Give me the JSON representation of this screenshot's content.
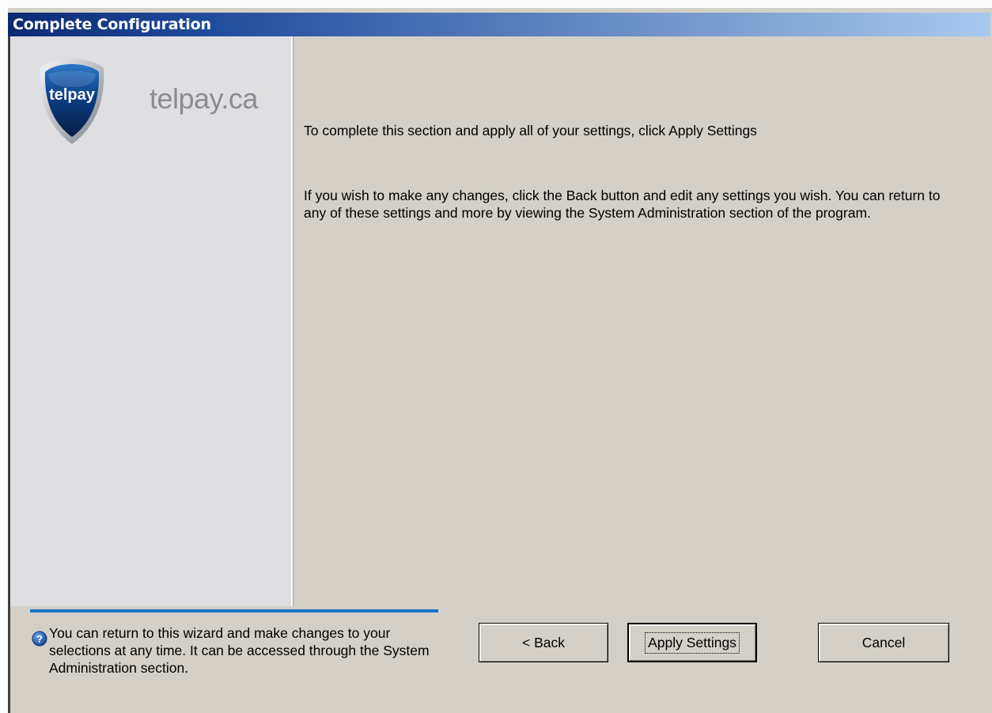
{
  "window": {
    "title": "Complete Configuration"
  },
  "sidebar": {
    "logo_text": "telpay",
    "site_text": "telpay.ca"
  },
  "content": {
    "instruction": "To complete this section and apply all of your settings, click Apply Settings",
    "details": "If you wish to make any changes, click the Back button and edit any settings you wish. You can return to any of these settings and more by viewing the System Administration section of the program."
  },
  "footer": {
    "help_text": "You can return to this wizard and make changes to your selections at any time.  It can be accessed through the System Administration section.",
    "help_icon": "help-icon",
    "accent_color": "#1a73c8"
  },
  "buttons": {
    "back": "< Back",
    "apply": "Apply Settings",
    "cancel": "Cancel"
  },
  "colors": {
    "titlebar_start": "#0c2a72",
    "titlebar_end": "#a8c9ee",
    "dialog_bg": "#d4d0c8",
    "sidebar_bg": "#dfdfe1"
  }
}
